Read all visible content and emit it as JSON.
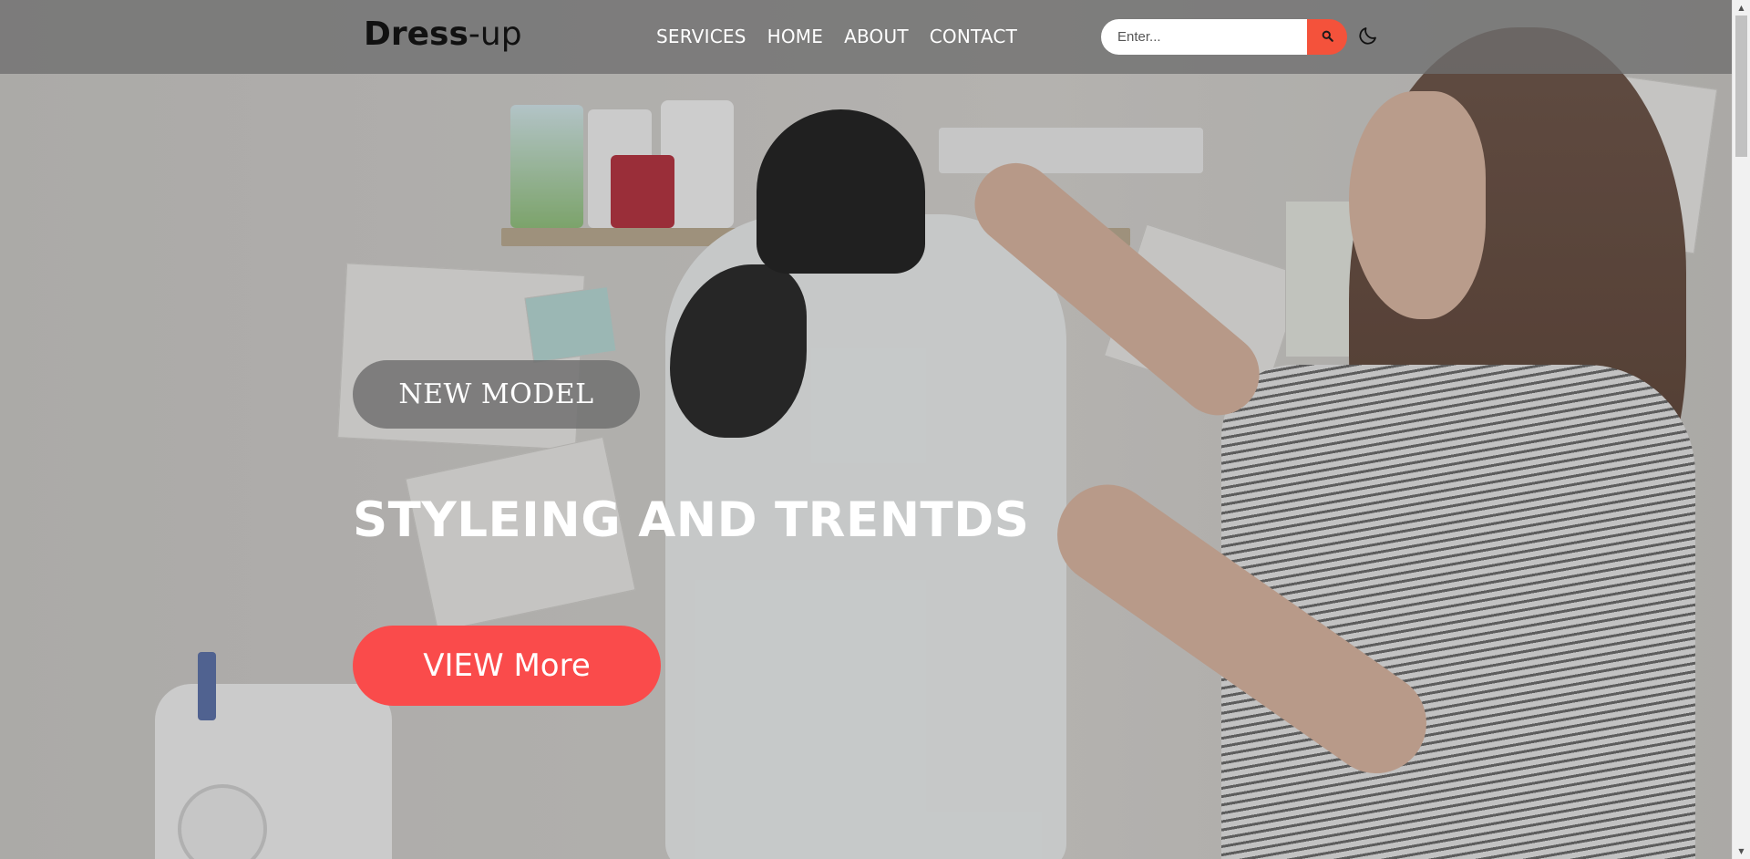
{
  "brand": {
    "part1": "Dress",
    "part2": "-up"
  },
  "nav": {
    "links": [
      {
        "label": "SERVICES"
      },
      {
        "label": "HOME"
      },
      {
        "label": "ABOUT"
      },
      {
        "label": "CONTACT"
      }
    ]
  },
  "search": {
    "placeholder": "Enter...",
    "value": "",
    "button_icon": "search-icon"
  },
  "theme_toggle": {
    "icon": "moon-icon"
  },
  "hero": {
    "badge": "NEW MODEL",
    "headline": "STYLEING AND TRENTDS",
    "cta": "VIEW More",
    "image": "seamstress-mannequin-photo"
  },
  "colors": {
    "accent": "#f4523b",
    "cta": "#fa4b4b",
    "navbar": "#6e6e6e"
  }
}
